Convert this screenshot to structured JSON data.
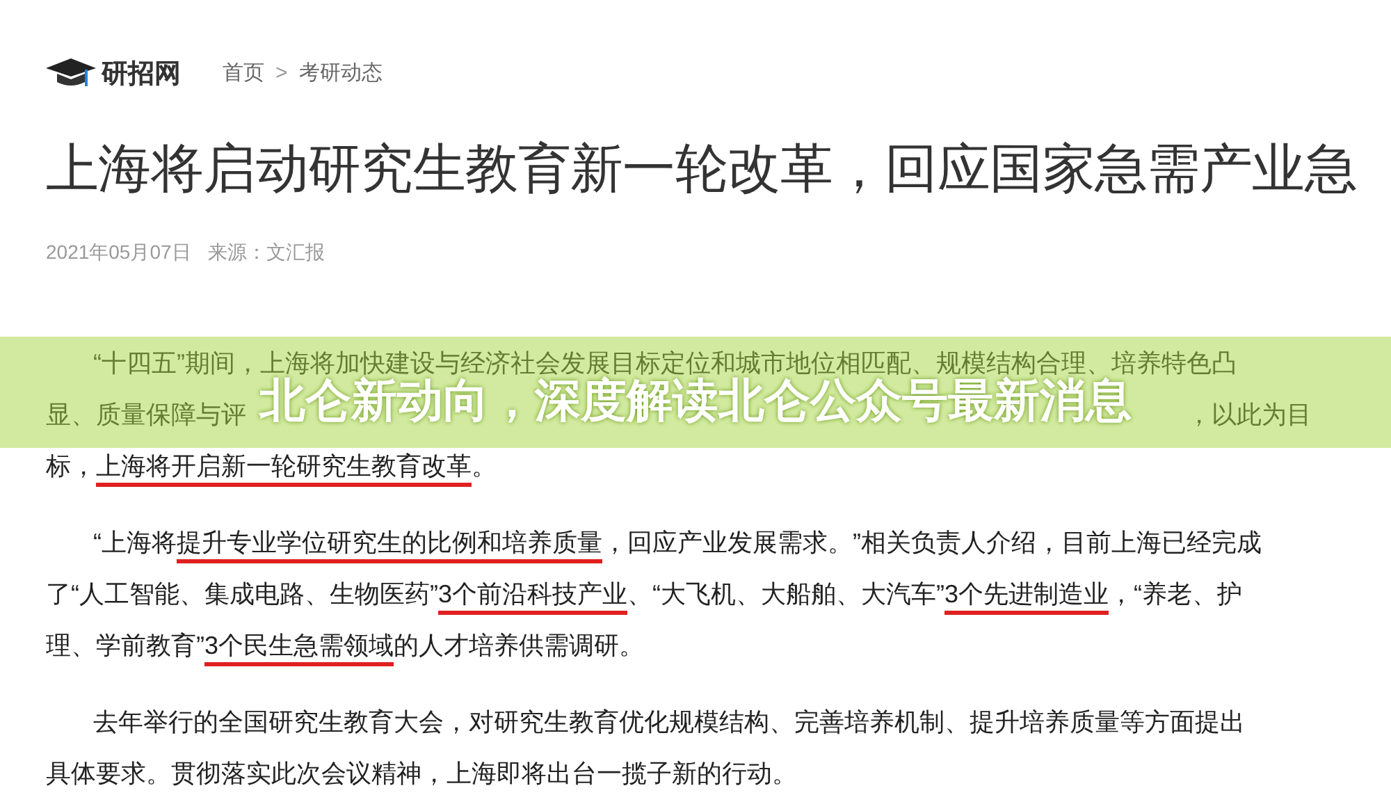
{
  "header": {
    "site_name": "研招网",
    "breadcrumb": [
      {
        "label": "首页"
      },
      {
        "label": ">"
      },
      {
        "label": "考研动态"
      }
    ]
  },
  "article": {
    "title": "上海将启动研究生教育新一轮改革，回应国家急需产业急",
    "date": "2021年05月07日",
    "source": "来源：文汇报",
    "paragraphs": [
      {
        "lines": [
          [
            {
              "text": "“十四五”期间，上海将加快建设与经济社会发展目标定位和城市地位相匹配、规模结构合理、培养特色凸"
            }
          ],
          {
            "left": "显、质量保障与评",
            "right": "，以此为目"
          },
          [
            {
              "text": "标，"
            },
            {
              "text": "上海将开启新一轮研究生教育改革",
              "underlined": true
            },
            {
              "text": "。"
            }
          ]
        ]
      },
      {
        "lines": [
          [
            {
              "text": "“上海将"
            },
            {
              "text": "提升专业学位研究生的比例和培养质量",
              "underlined": true
            },
            {
              "text": "，回应产业发展需求。”相关负责人介绍，目前上海已经完成"
            }
          ],
          [
            {
              "text": "了“人工智能、集成电路、生物医药”"
            },
            {
              "text": "3个前沿科技产业",
              "underlined": true
            },
            {
              "text": "、“大飞机、大船舶、大汽车”"
            },
            {
              "text": "3个先进制造业",
              "underlined": true
            },
            {
              "text": "，“养老、护"
            }
          ],
          [
            {
              "text": "理、学前教育”"
            },
            {
              "text": "3个民生急需领域",
              "underlined": true
            },
            {
              "text": "的人才培养供需调研。"
            }
          ]
        ]
      },
      {
        "lines": [
          [
            {
              "text": "去年举行的全国研究生教育大会，对研究生教育优化规模结构、完善培养机制、提升培养质量等方面提出"
            }
          ],
          [
            {
              "text": "具体要求。贯彻落实此次会议精神，上海即将出台一揽子新的行动。"
            }
          ]
        ]
      }
    ]
  },
  "banner": {
    "text": "北仑新动向，深度解读北仑公众号最新消息"
  }
}
